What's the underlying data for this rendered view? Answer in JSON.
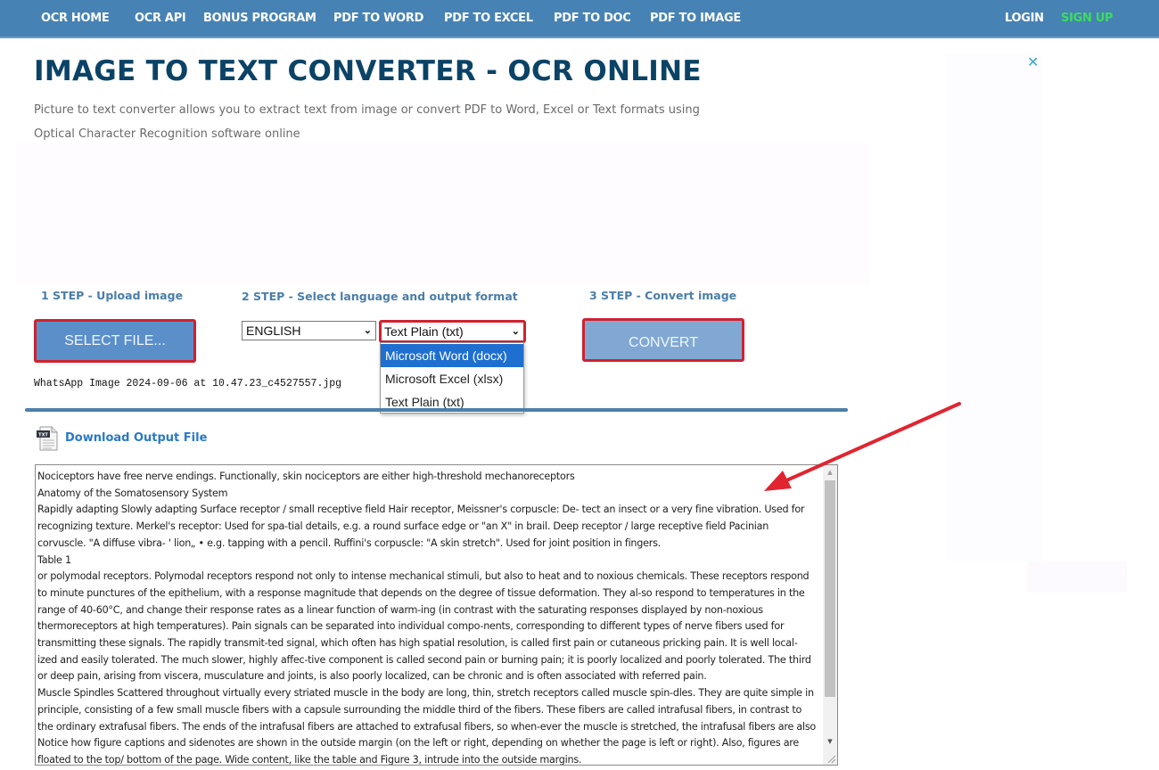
{
  "nav": {
    "items": [
      {
        "label": "OCR HOME"
      },
      {
        "label": "OCR API"
      },
      {
        "label": "BONUS PROGRAM"
      },
      {
        "label": "PDF TO WORD"
      },
      {
        "label": "PDF TO EXCEL"
      },
      {
        "label": "PDF TO DOC"
      },
      {
        "label": "PDF TO IMAGE"
      }
    ],
    "login": "LOGIN",
    "signup": "SIGN UP"
  },
  "header": {
    "title": "IMAGE TO TEXT CONVERTER - OCR ONLINE",
    "subtitle": "Picture to text converter allows you to extract text from image or convert PDF to Word, Excel or Text formats using Optical Character Recognition software online"
  },
  "ad": {
    "close_glyph": "✕"
  },
  "steps": {
    "step1": {
      "label": "1 STEP - Upload image",
      "button": "SELECT FILE...",
      "filename": "WhatsApp Image 2024-09-06 at 10.47.23_c4527557.jpg"
    },
    "step2": {
      "label": "2 STEP - Select language and output format",
      "language": "ENGLISH",
      "format": "Text Plain (txt)",
      "format_options": [
        {
          "label": "Microsoft Word (docx)",
          "highlighted": true
        },
        {
          "label": "Microsoft Excel (xlsx)",
          "highlighted": false
        },
        {
          "label": "Text Plain (txt)",
          "highlighted": false
        }
      ]
    },
    "step3": {
      "label": "3 STEP - Convert image",
      "button": "CONVERT"
    }
  },
  "output": {
    "download_label": "Download Output File",
    "file_icon_label": "TXT",
    "lines": [
      "Nociceptors have free nerve endings. Functionally, skin nociceptors are either high-threshold mechanoreceptors",
      "Anatomy of the Somatosensory System",
      "Rapidly adapting Slowly adapting Surface receptor / small receptive field Hair receptor, Meissner's corpuscle: De- tect an insect or a very fine vibration. Used for",
      "recognizing texture. Merkel's receptor: Used for spa-tial details, e.g. a round surface edge or \"an X\" in brail. Deep receptor / large receptive field Pacinian",
      "corvuscle. \"A diffuse vibra- ' lion„ • e.g. tapping with a pencil. Ruffini's corpuscle: \"A skin stretch\". Used for joint position in fingers.",
      "Table 1",
      "or polymodal receptors. Polymodal receptors respond not only to intense mechanical stimuli, but also to heat and to noxious chemicals. These receptors respond",
      "to minute punctures of the epithelium, with a response magnitude that depends on the degree of tissue deformation. They al-so respond to temperatures in the",
      "range of 40-60°C, and change their response rates as a linear function of warm-ing (in contrast with the saturating responses displayed by non-noxious",
      "thermoreceptors at high temperatures). Pain signals can be separated into individual compo-nents, corresponding to different types of nerve fibers used for",
      "transmitting these signals. The rapidly transmit-ted signal, which often has high spatial resolution, is called first pain or cutaneous pricking pain. It is well local-",
      "ized and easily tolerated. The much slower, highly affec-tive component is called second pain or burning pain; it is poorly localized and poorly tolerated. The third",
      "or deep pain, arising from viscera, musculature and joints, is also poorly localized, can be chronic and is often associated with referred pain.",
      "Muscle Spindles Scattered throughout virtually every striated muscle in the body are long, thin, stretch receptors called muscle spin-dles. They are quite simple in",
      "principle, consisting of a few small muscle fibers with a capsule surrounding the middle third of the fibers. These fibers are called intrafusal fibers, in contrast to",
      "the ordinary extrafusal fibers. The ends of the intrafusal fibers are attached to extrafusal fibers, so when-ever the muscle is stretched, the intrafusal fibers are also",
      "Notice how figure captions and sidenotes are shown in the outside margin (on the left or right, depending on whether the page is left or right). Also, figures are",
      "floated to the top/ bottom of the page. Wide content, like the table and Figure 3, intrude into the outside margins."
    ]
  },
  "colors": {
    "nav_bg": "#4682b4",
    "signup": "#3ddc5c",
    "title": "#0b4366",
    "step_label": "#4a7ea8",
    "highlight_border": "#d0212f",
    "button_select": "#5b8fc9",
    "button_convert": "#80a8d3",
    "link": "#2a78c8",
    "annotation_arrow": "#e02530"
  }
}
